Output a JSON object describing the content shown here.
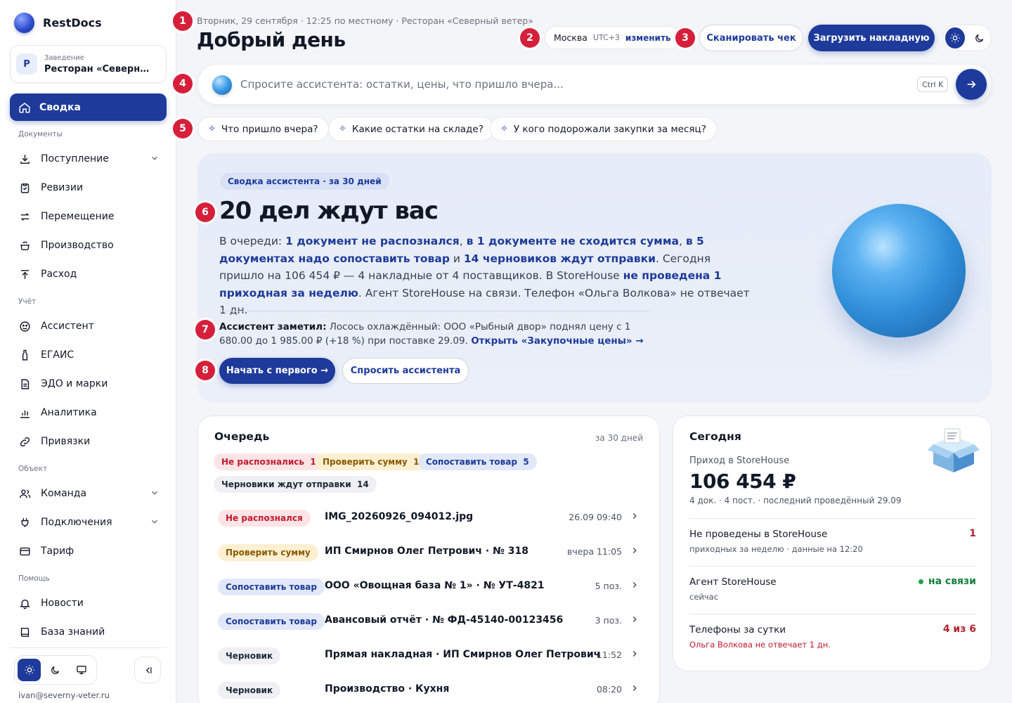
{
  "brand": {
    "name": "RestDocs"
  },
  "venue": {
    "label": "Заведение",
    "avatar": "Р",
    "name": "Ресторан «Северный ветер»"
  },
  "sidebar": {
    "active": {
      "label": "Сводка",
      "icon": "home-icon"
    },
    "sections": {
      "docs": "Документы",
      "accounting": "Учёт",
      "object": "Объект",
      "help": "Помощь"
    },
    "items": [
      {
        "label": "Поступление",
        "icon": "inbox-download-icon",
        "expand": true
      },
      {
        "label": "Ревизии",
        "icon": "clipboard-check-icon"
      },
      {
        "label": "Перемещение",
        "icon": "arrows-swap-icon"
      },
      {
        "label": "Производство",
        "icon": "pot-icon"
      },
      {
        "label": "Расход",
        "icon": "upload-icon"
      },
      {
        "label": "Ассистент",
        "icon": "assistant-icon"
      },
      {
        "label": "ЕГАИС",
        "icon": "bottle-icon"
      },
      {
        "label": "ЭДО и марки",
        "icon": "document-icon"
      },
      {
        "label": "Аналитика",
        "icon": "bar-chart-icon"
      },
      {
        "label": "Привязки",
        "icon": "link-icon"
      },
      {
        "label": "Команда",
        "icon": "users-icon",
        "expand": true
      },
      {
        "label": "Подключения",
        "icon": "plug-icon",
        "expand": true
      },
      {
        "label": "Тариф",
        "icon": "card-icon"
      },
      {
        "label": "Новости",
        "icon": "bell-icon"
      },
      {
        "label": "База знаний",
        "icon": "book-icon"
      }
    ],
    "user_email": "ivan@severny-veter.ru"
  },
  "header": {
    "date_line": "Вторник, 29 сентября · 12:25 по местному · Ресторан «Северный ветер»",
    "greeting": "Добрый день",
    "tz_city": "Москва",
    "tz_offset": "UTC+3",
    "tz_change": "изменить",
    "scan_button": "Сканировать чек",
    "upload_button": "Загрузить накладную"
  },
  "markers": [
    "1",
    "2",
    "3",
    "4",
    "5",
    "6",
    "7",
    "8"
  ],
  "ask": {
    "placeholder": "Спросите ассистента: остатки, цены, что пришло вчера...",
    "shortcut": "Ctrl K"
  },
  "chips": [
    "Что пришло вчера?",
    "Какие остатки на складе?",
    "У кого подорожали закупки за месяц?"
  ],
  "hero": {
    "tag": "Сводка ассистента · за 30 дней",
    "title": "20 дел ждут вас",
    "t1": "В очереди: ",
    "b1": "1 документ не распознался",
    "t2": ", ",
    "b2": "в 1 документе не сходится сумма",
    "t3": ", ",
    "b3": "в 5 документах надо сопоставить товар",
    "t4": " и ",
    "b4": "14 черновиков ждут отправки",
    "t5": ". Сегодня пришло на 106 454 ₽ — 4 накладные от 4 поставщиков. В StoreHouse ",
    "b5": "не проведена 1 приходная за неделю",
    "t6": ". Агент StoreHouse на связи. Телефон «Ольга Волкова» не отвечает 1 дн.",
    "note_title": "Ассистент заметил:",
    "note_text": " Лосось охлаждённый: ООО «Рыбный двор» поднял цену с 1 680.00 до 1 985.00 ₽ (+18 %) при поставке 29.09. ",
    "note_link": "Открыть «Закупочные цены» →",
    "start_button": "Начать с первого →",
    "ask_button": "Спросить ассистента"
  },
  "queue": {
    "title": "Очередь",
    "period": "за 30 дней",
    "filters": [
      {
        "label": "Не распознались",
        "count": "1"
      },
      {
        "label": "Проверить сумму",
        "count": "1"
      },
      {
        "label": "Сопоставить товар",
        "count": "5"
      },
      {
        "label": "Черновики ждут отправки",
        "count": "14"
      }
    ],
    "rows": [
      {
        "status": "Не распознался",
        "name": "IMG_20260926_094012.jpg",
        "meta": "26.09 09:40"
      },
      {
        "status": "Проверить сумму",
        "name": "ИП Смирнов Олег Петрович · № 318",
        "meta": "вчера 11:05"
      },
      {
        "status": "Сопоставить товар",
        "name": "ООО «Овощная база № 1» · № УТ-4821",
        "meta": "5 поз."
      },
      {
        "status": "Сопоставить товар",
        "name": "Авансовый отчёт · № ФД-45140-00123456",
        "meta": "3 поз."
      },
      {
        "status": "Черновик",
        "name": "Прямая накладная · ИП Смирнов Олег Петрович",
        "meta": "11:52"
      },
      {
        "status": "Черновик",
        "name": "Производство · Кухня",
        "meta": "08:20"
      }
    ]
  },
  "today": {
    "title": "Сегодня",
    "sub": "Приход в StoreHouse",
    "amount": "106 454 ₽",
    "meta": "4 док. · 4 пост. · последний проведённый 29.09",
    "rows": [
      {
        "title": "Не проведены в StoreHouse",
        "sub": "приходных за неделю · данные на 12:20",
        "value": "1"
      },
      {
        "title": "Агент StoreHouse",
        "sub": "сейчас",
        "value": "на связи"
      },
      {
        "title": "Телефоны за сутки",
        "sub": "Ольга Волкова не отвечает 1 дн.",
        "value": "4 из 6"
      }
    ]
  },
  "colors": {
    "accent": "#1e3a9a",
    "danger": "#d61f3a",
    "success": "#15803d"
  }
}
